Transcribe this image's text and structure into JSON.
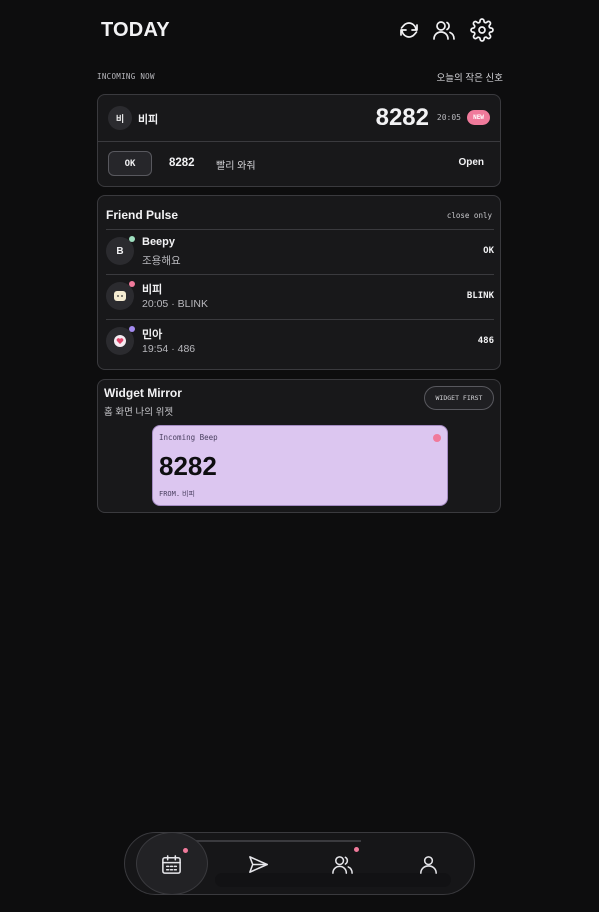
{
  "header": {
    "title": "TODAY",
    "icons": [
      "refresh-icon",
      "friends-icon",
      "settings-icon"
    ]
  },
  "incoming": {
    "section_label": "INCOMING NOW",
    "section_right": "오늘의 작은 신호",
    "avatar_initial": "비",
    "sender": "비피",
    "code": "8282",
    "time": "20:05",
    "badge": "NEW",
    "ok_label": "OK",
    "message_code": "8282",
    "message_text": "빨리 와줘",
    "open_label": "Open"
  },
  "friend_pulse": {
    "title": "Friend Pulse",
    "filter_label": "close only",
    "friends": [
      {
        "initial": "B",
        "name": "Beepy",
        "sub": "조용해요",
        "status": "OK",
        "dot_color": "#9fe0c0",
        "avatar_icon": "letter"
      },
      {
        "initial": "",
        "name": "비피",
        "sub": "20:05 · BLINK",
        "status": "BLINK",
        "dot_color": "#f07a9b",
        "avatar_icon": "marshmallow-icon"
      },
      {
        "initial": "",
        "name": "민아",
        "sub": "19:54 · 486",
        "status": "486",
        "dot_color": "#a48bf0",
        "avatar_icon": "heart-sticker-icon"
      }
    ]
  },
  "widget_mirror": {
    "title": "Widget Mirror",
    "subtitle": "홈 화면 나의 위젯",
    "button_label": "WIDGET FIRST",
    "widget": {
      "label": "Incoming Beep",
      "code": "8282",
      "from_label": "FROM.",
      "from_name": "비피",
      "bg_color": "#dcc6f0",
      "dot_color": "#f07a9b"
    }
  },
  "bottom_nav": {
    "items": [
      "calendar-icon",
      "send-icon",
      "friends-icon",
      "profile-icon"
    ],
    "active": "calendar-icon",
    "accent": "#f07a9b"
  }
}
